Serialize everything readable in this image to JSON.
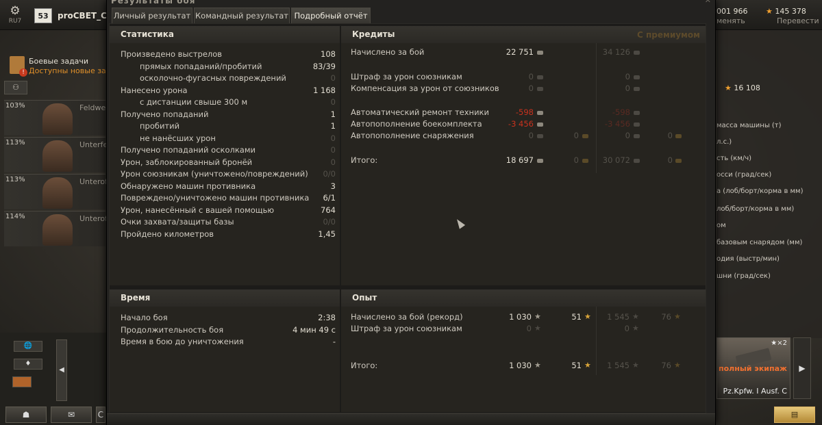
{
  "topbar": {
    "settings_glyph": "⚙",
    "server": "RU7",
    "level": "53",
    "player": "proCBET_Cm",
    "gold": "001 966",
    "gold_action": "менять",
    "credits": "145 378",
    "credits_action": "Перевести"
  },
  "missions": {
    "title": "Боевые задачи",
    "subtitle": "Доступны новые задачи"
  },
  "crew_toggle": "⚇",
  "crew": [
    {
      "percent": "103%",
      "rank": "Feldwebel"
    },
    {
      "percent": "113%",
      "rank": "Unterfeldwebel"
    },
    {
      "percent": "113%",
      "rank": "Unteroffizier"
    },
    {
      "percent": "114%",
      "rank": "Unteroffizier"
    }
  ],
  "right_panel": {
    "experience": "16 108",
    "rows": [
      "масса машины (т)",
      "л.с.)",
      "сть (км/ч)",
      "осси (град/сек)",
      "а (лоб/борт/корма в мм)",
      "лоб/борт/корма в мм)",
      "ом",
      "базовым снарядом (мм)",
      "одия (выстр/мин)",
      "шни (град/сек)"
    ],
    "tank_card": {
      "badge": "★×2",
      "crew_label": "полный экипаж",
      "name": "Pz.Kpfw. I Ausf. C"
    },
    "arrow": "▶",
    "chat_icon": "▤"
  },
  "bottom_left": {
    "globe": "🌐",
    "diamond": "♦",
    "arrow": "◀",
    "btn1": "☗",
    "btn2": "✉",
    "btn3": "С"
  },
  "window": {
    "title": "Результаты боя",
    "close": "✕",
    "tabs": [
      "Личный результат",
      "Командный результат",
      "Подробный отчёт"
    ]
  },
  "statistics": {
    "header": "Статистика",
    "rows": [
      {
        "label": "Произведено выстрелов",
        "value": "108",
        "indent": false,
        "dim": false
      },
      {
        "label": "прямых попаданий/пробитий",
        "value": "83/39",
        "indent": true,
        "dim": false
      },
      {
        "label": "осколочно-фугасных повреждений",
        "value": "0",
        "indent": true,
        "dim": true
      },
      {
        "label": "Нанесено урона",
        "value": "1 168",
        "indent": false,
        "dim": false
      },
      {
        "label": "с дистанции свыше 300 м",
        "value": "0",
        "indent": true,
        "dim": true
      },
      {
        "label": "Получено попаданий",
        "value": "1",
        "indent": false,
        "dim": false
      },
      {
        "label": "пробитий",
        "value": "1",
        "indent": true,
        "dim": false
      },
      {
        "label": "не нанёсших урон",
        "value": "0",
        "indent": true,
        "dim": true
      },
      {
        "label": "Получено попаданий осколками",
        "value": "0",
        "indent": false,
        "dim": true
      },
      {
        "label": "Урон, заблокированный бронёй",
        "value": "0",
        "indent": false,
        "dim": true
      },
      {
        "label": "Урон союзникам (уничтожено/повреждений)",
        "value": "0/0",
        "indent": false,
        "dim": true
      },
      {
        "label": "Обнаружено машин противника",
        "value": "3",
        "indent": false,
        "dim": false
      },
      {
        "label": "Повреждено/уничтожено машин противника",
        "value": "6/1",
        "indent": false,
        "dim": false
      },
      {
        "label": "Урон, нанесённый с вашей помощью",
        "value": "764",
        "indent": false,
        "dim": false
      },
      {
        "label": "Очки захвата/защиты базы",
        "value": "0/0",
        "indent": false,
        "dim": true
      },
      {
        "label": "Пройдено километров",
        "value": "1,45",
        "indent": false,
        "dim": false
      }
    ]
  },
  "credits": {
    "header": "Кредиты",
    "premium_header": "С премиумом",
    "rows": [
      {
        "label": "Начислено за бой",
        "base": "22 751",
        "base_gold": null,
        "prem": "34 126",
        "prem_gold": null,
        "style": "normal"
      },
      {
        "label": "Штраф за урон союзникам",
        "base": "0",
        "base_gold": null,
        "prem": "0",
        "prem_gold": null,
        "style": "dim"
      },
      {
        "label": "Компенсация за урон от союзников",
        "base": "0",
        "base_gold": null,
        "prem": "0",
        "prem_gold": null,
        "style": "dim"
      },
      {
        "label": "Автоматический ремонт техники",
        "base": "-598",
        "base_gold": null,
        "prem": "-598",
        "prem_gold": null,
        "style": "red"
      },
      {
        "label": "Автопополнение боекомплекта",
        "base": "-3 456",
        "base_gold": null,
        "prem": "-3 456",
        "prem_gold": null,
        "style": "red"
      },
      {
        "label": "Автопополнение снаряжения",
        "base": "0",
        "base_gold": "0",
        "prem": "0",
        "prem_gold": "0",
        "style": "dim"
      },
      {
        "label": "Итого:",
        "base": "18 697",
        "base_gold": "0",
        "prem": "30 072",
        "prem_gold": "0",
        "style": "total"
      }
    ]
  },
  "time": {
    "header": "Время",
    "rows": [
      {
        "label": "Начало боя",
        "value": "2:38"
      },
      {
        "label": "Продолжительность боя",
        "value": "4 мин 49 с"
      },
      {
        "label": "Время в бою до уничтожения",
        "value": "-"
      }
    ]
  },
  "experience": {
    "header": "Опыт",
    "rows": [
      {
        "label": "Начислено за бой (рекорд)",
        "base": "1 030",
        "base_free": "51",
        "prem": "1 545",
        "prem_free": "76",
        "style": "normal"
      },
      {
        "label": "Штраф за урон союзникам",
        "base": "0",
        "base_free": null,
        "prem": "0",
        "prem_free": null,
        "style": "dim"
      },
      {
        "label": "Итого:",
        "base": "1 030",
        "base_free": "51",
        "prem": "1 545",
        "prem_free": "76",
        "style": "total"
      }
    ]
  }
}
